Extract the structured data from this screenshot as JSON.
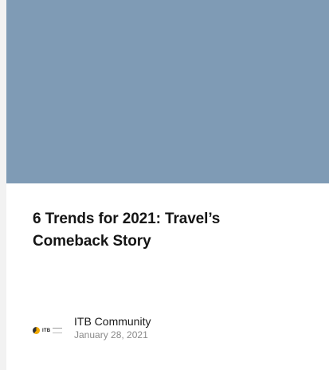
{
  "article": {
    "title": "6 Trends for 2021: Travel’s Comeback Story",
    "hero_color": "#7f9bb5"
  },
  "author": {
    "logo_text": "ITB",
    "name": "ITB Community",
    "date": "January 28, 2021"
  }
}
